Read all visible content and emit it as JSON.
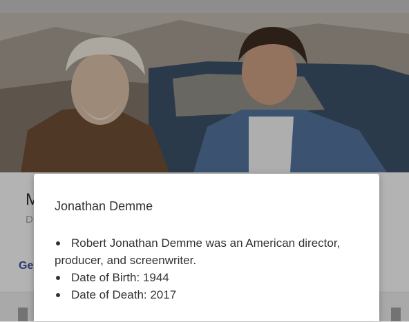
{
  "hero": {
    "image_desc_icon": "photo-still"
  },
  "card": {
    "title_initial": "M",
    "subtitle_initial": "D",
    "link_text": "Ge"
  },
  "tooltip": {
    "title": "Jonathan Demme",
    "items": [
      "Robert Jonathan Demme was an American director, producer, and screenwriter.",
      "Date of Birth: 1944",
      "Date of Death: 2017"
    ]
  }
}
